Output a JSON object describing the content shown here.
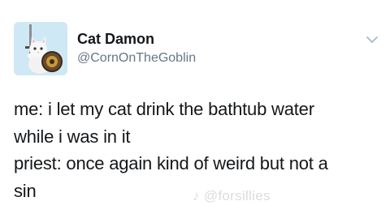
{
  "author": {
    "display_name": "Cat Damon",
    "handle": "@CornOnTheGoblin"
  },
  "tweet": {
    "lines": [
      "me: i let my cat drink the bathtub water",
      "while i was in it",
      "priest: once again kind of weird but not a",
      "sin"
    ]
  },
  "watermark": {
    "text": "@forsillies",
    "icon": "tiktok-icon"
  },
  "icons": {
    "avatar": "cat-knight-avatar",
    "menu": "chevron-down-icon"
  },
  "colors": {
    "name": "#14171a",
    "handle": "#657786",
    "body": "#14171a",
    "watermark": "#dcdcdc"
  }
}
